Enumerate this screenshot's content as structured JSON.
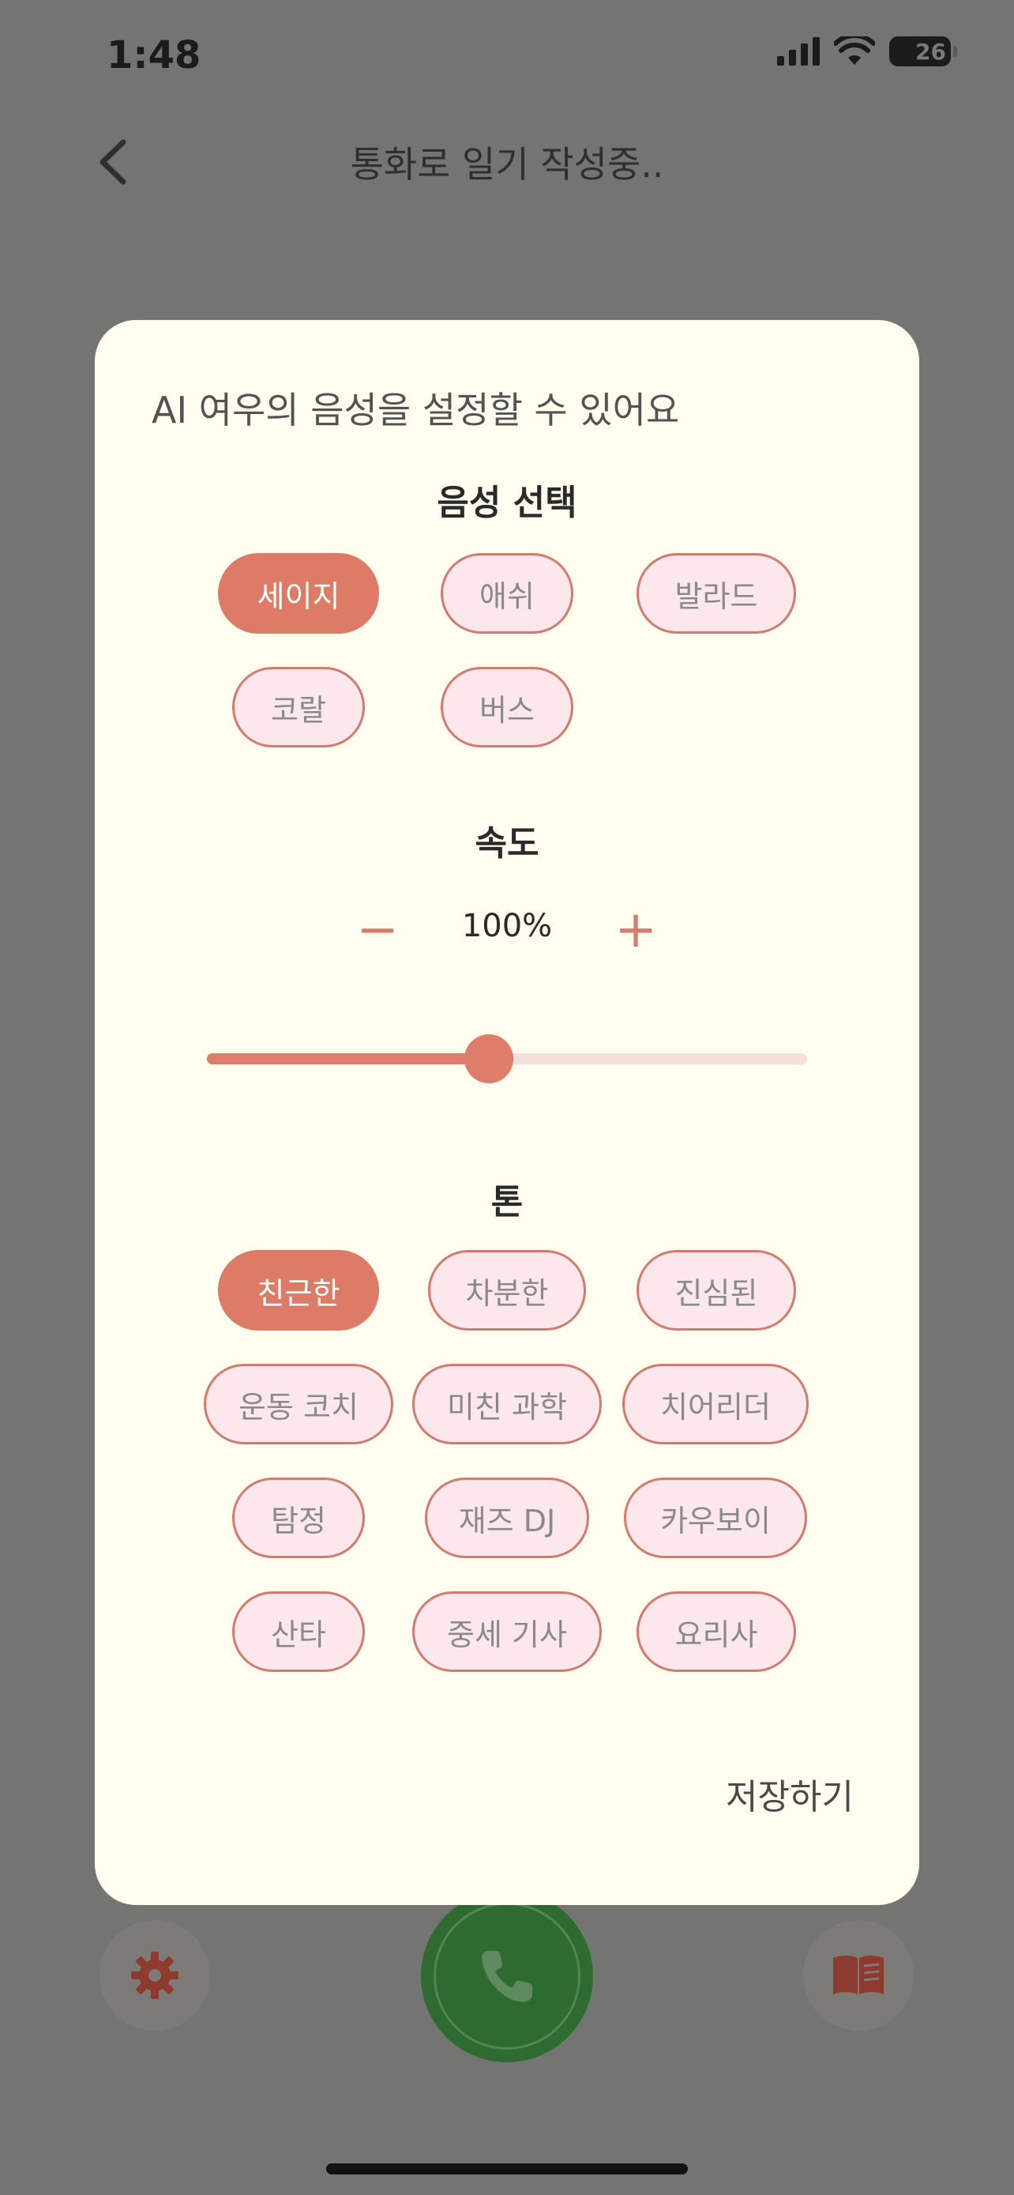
{
  "status_bar": {
    "time": "1:48",
    "battery": "26"
  },
  "nav": {
    "title": "통화로 일기 작성중.."
  },
  "modal": {
    "heading": "AI 여우의 음성을 설정할 수 있어요",
    "voice_section": {
      "title": "음성 선택",
      "options": [
        "세이지",
        "애쉬",
        "발라드",
        "코랄",
        "버스"
      ],
      "selected": "세이지"
    },
    "speed_section": {
      "title": "속도",
      "value_label": "100%",
      "minus_label": "−",
      "plus_label": "+",
      "slider_fraction": 0.47
    },
    "tone_section": {
      "title": "톤",
      "options": [
        "친근한",
        "차분한",
        "진심된",
        "운동 코치",
        "미친 과학",
        "치어리더",
        "탐정",
        "재즈 DJ",
        "카우보이",
        "산타",
        "중세 기사",
        "요리사"
      ],
      "selected": "친근한"
    },
    "save_label": "저장하기"
  },
  "colors": {
    "accent": "#de7b67",
    "chip_bg": "#fbe7ec",
    "modal_bg": "#fffcf0",
    "call_green": "#2e6b30",
    "overlay": "#747472"
  },
  "icons": {
    "back": "chevron-left-icon",
    "settings": "gear-icon",
    "call": "phone-icon",
    "diary": "book-icon"
  }
}
